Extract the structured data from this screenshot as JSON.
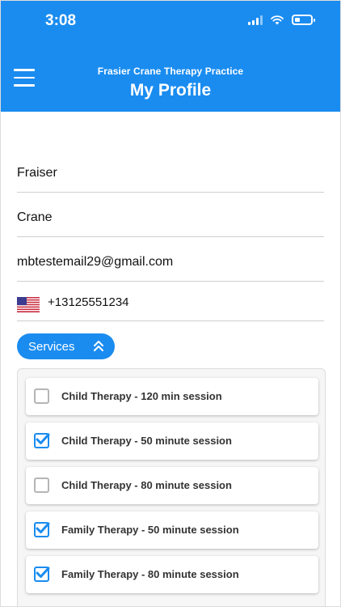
{
  "status": {
    "time": "3:08",
    "icons": [
      "signal-icon",
      "wifi-icon",
      "battery-icon"
    ],
    "battery_level": 0.35
  },
  "header": {
    "subtitle": "Frasier Crane Therapy Practice",
    "title": "My Profile",
    "background": "#1a8cf0"
  },
  "form": {
    "first_name": "Fraiser",
    "last_name": "Crane",
    "email": "mbtestemail29@gmail.com",
    "phone": "+13125551234",
    "phone_country": "us-flag-icon"
  },
  "services": {
    "button_label": "Services",
    "expanded": true,
    "items": [
      {
        "label": "Child Therapy - 120 min session",
        "checked": false
      },
      {
        "label": "Child Therapy - 50 minute session",
        "checked": true
      },
      {
        "label": "Child Therapy - 80 minute session",
        "checked": false
      },
      {
        "label": "Family Therapy - 50 minute session",
        "checked": true
      },
      {
        "label": "Family Therapy - 80 minute session",
        "checked": true
      }
    ]
  },
  "colors": {
    "accent": "#1a8cf0",
    "divider": "#cfcfcf"
  }
}
